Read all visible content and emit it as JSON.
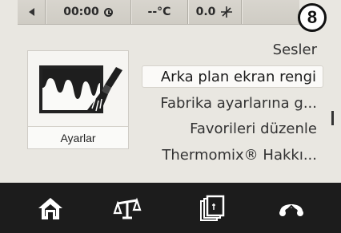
{
  "status_bar": {
    "time": "00:00",
    "temperature": "--°C",
    "speed": "0.0",
    "step_number": "8"
  },
  "tile": {
    "label": "Ayarlar",
    "icon": "paint-brush-icon"
  },
  "menu": {
    "items": [
      {
        "label": "Sesler",
        "selected": false
      },
      {
        "label": "Arka plan ekran rengi",
        "selected": true
      },
      {
        "label": "Fabrika ayarlarına g...",
        "selected": false
      },
      {
        "label": "Favorileri düzenle",
        "selected": false
      },
      {
        "label": "Thermomix® Hakkı...",
        "selected": false
      }
    ]
  },
  "bottom_bar": {
    "icons": [
      "home-icon",
      "scale-icon",
      "recipe-book-icon",
      "turbo-icon"
    ]
  },
  "colors": {
    "screen_bg": "#e9e7e1",
    "bottom_bg": "#1c1c1c",
    "text": "#333333"
  }
}
